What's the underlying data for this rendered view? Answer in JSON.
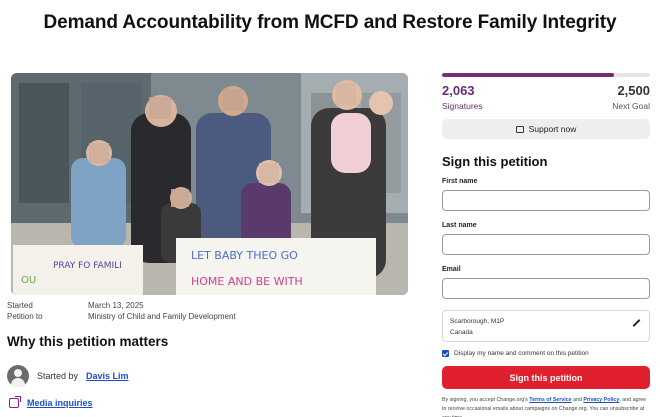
{
  "page": {
    "title": "Demand Accountability from MCFD and Restore Family Integrity"
  },
  "photo": {
    "sign_left": "PRAY FO FAMILI",
    "sign_left_small": "OU",
    "sign_right_line1": "LET BABY THEO GO",
    "sign_right_line2": "HOME AND BE WITH"
  },
  "meta": {
    "started_label": "Started",
    "started_value": "March 13, 2025",
    "petition_to_label": "Petition to",
    "petition_to_value": "Ministry of Child and Family Development"
  },
  "section": {
    "why_heading": "Why this petition matters"
  },
  "starter": {
    "prefix": "Started by",
    "name": "Davis Lim"
  },
  "media": {
    "label": "Media inquiries"
  },
  "progress": {
    "signatures": "2,063",
    "signatures_label": "Signatures",
    "goal": "2,500",
    "goal_label": "Next Goal",
    "fraction": 0.8252
  },
  "support": {
    "label": "Support now"
  },
  "form": {
    "heading": "Sign this petition",
    "first_name_label": "First name",
    "last_name_label": "Last name",
    "email_label": "Email",
    "location_line1": "Scarborough, M1P",
    "location_line2": "Canada",
    "display_label": "Display my name and comment on this petition",
    "submit_label": "Sign this petition",
    "fine_prefix": "By signing, you accept Change.org's ",
    "terms_label": "Terms of Service",
    "fine_and": " and ",
    "privacy_label": "Privacy Policy",
    "fine_suffix": ", and agree to receive occasional emails about campaigns on Change.org. You can unsubscribe at any time."
  },
  "colors": {
    "accent": "#6b2c76",
    "button": "#e0202e",
    "link": "#1d4fc4"
  }
}
